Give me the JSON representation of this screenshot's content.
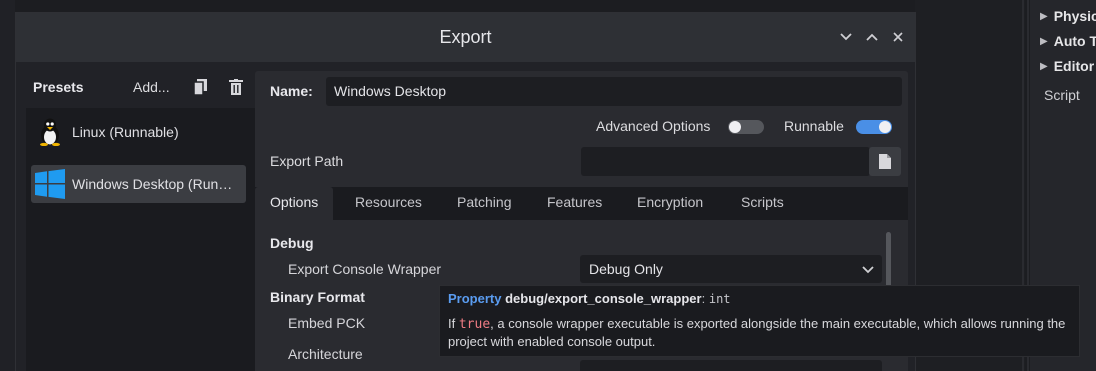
{
  "background": {
    "inspector_rows": [
      "Physics",
      "Auto Tile",
      "Editor"
    ],
    "inspector_plain": "Script"
  },
  "dialog": {
    "title": "Export",
    "presets_label": "Presets",
    "add_label": "Add...",
    "presets": [
      {
        "label": "Linux (Runnable)",
        "icon": "linux-tux-icon",
        "selected": false
      },
      {
        "label": "Windows Desktop (Runnable)",
        "icon": "windows-logo-icon",
        "selected": true
      }
    ],
    "name_label": "Name:",
    "name_value": "Windows Desktop",
    "advanced_options_label": "Advanced Options",
    "advanced_options_on": false,
    "runnable_label": "Runnable",
    "runnable_on": true,
    "export_path_label": "Export Path",
    "export_path_value": "",
    "tabs": [
      "Options",
      "Resources",
      "Patching",
      "Features",
      "Encryption",
      "Scripts"
    ],
    "active_tab": "Options",
    "options": {
      "debug_section": "Debug",
      "export_console_wrapper_label": "Export Console Wrapper",
      "export_console_wrapper_value": "Debug Only",
      "binary_format_section": "Binary Format",
      "embed_pck_label": "Embed PCK",
      "architecture_label": "Architecture"
    }
  },
  "tooltip": {
    "kind": "Property",
    "name": "debug/export_console_wrapper",
    "colon": ":",
    "type": "int",
    "desc_prefix": "If ",
    "desc_code": "true",
    "desc_rest": ", a console wrapper executable is exported alongside the main executable, which allows running the project with enabled console output."
  },
  "colors": {
    "accent": "#4a8fe6",
    "keyword": "#5a9cf0",
    "code": "#f07c84"
  }
}
